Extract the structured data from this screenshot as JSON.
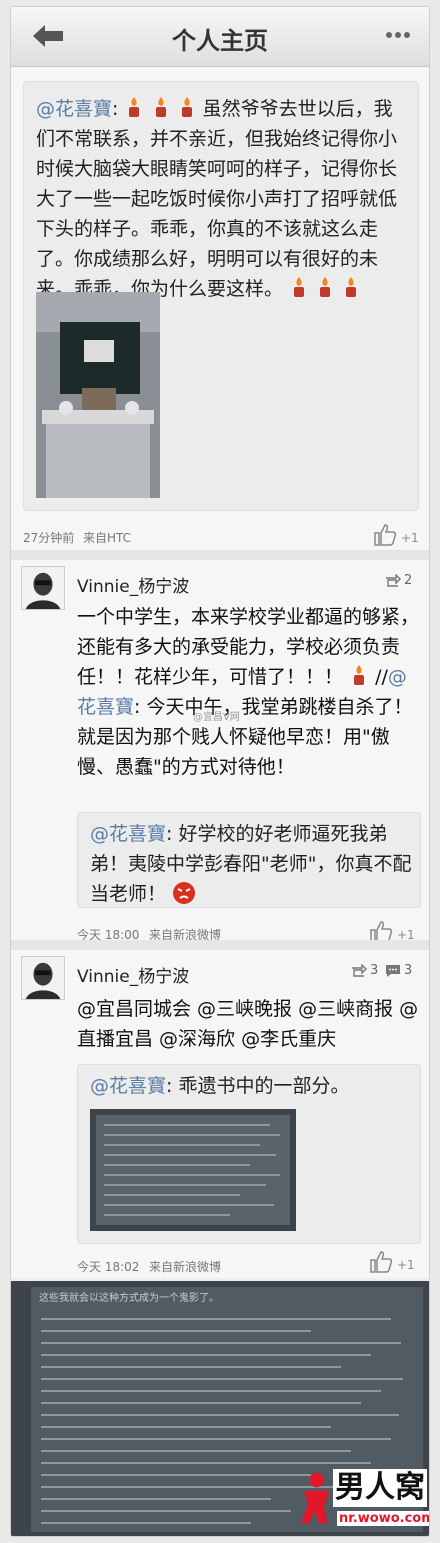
{
  "header": {
    "title": "个人主页"
  },
  "post1": {
    "mention": "@花喜寶",
    "text": "虽然爷爷去世以后，我们不常联系，并不亲近，但我始终记得你小时候大脑袋大眼睛笑呵呵的样子，记得你长大了一些一起吃饭时候你小声打了招呼就低下头的样子。乖乖，你真的不该就这么走了。你成绩那么好，明明可以有很好的未来。乖乖，你为什么要这样。",
    "time": "27分钟前",
    "source": "来自HTC",
    "likes": "+1"
  },
  "post2": {
    "user": "Vinnie_杨宁波",
    "reposts": "2",
    "text_a": "一个中学生，本来学校学业都逼的够紧，还能有多大的承受能力，学校必须负责任！！花样少年，可惜了！！！",
    "text_b_prefix": "//",
    "mention": "@花喜寶",
    "text_c": ": 今天中午，我堂弟跳楼自杀了！就是因为那个贱人怀疑他早恋！用\"傲慢、愚蠢\"的方式对待他！",
    "watermark": "@宜昌V网",
    "quote_mention": "@花喜寶",
    "quote_text": ": 好学校的好老师逼死我弟弟！夷陵中学彭春阳\"老师\"，你真不配当老师！",
    "time": "今天 18:00",
    "source": "来自新浪微博",
    "likes": "+1"
  },
  "post3": {
    "user": "Vinnie_杨宁波",
    "reposts": "3",
    "comments": "3",
    "mentions": "@宜昌同城会 @三峡晚报 @三峡商报 @直播宜昌 @深海欣 @李氏重庆",
    "quote_mention": "@花喜寶",
    "quote_text": ": 乖遗书中的一部分。",
    "time": "今天 18:02",
    "source": "来自新浪微博",
    "likes": "+1"
  },
  "bottom_photo": {
    "top_line": "这些我就会以这种方式成为一个鬼影了。",
    "logo_text": "男人窝",
    "logo_url": "nr.wowo.com"
  },
  "colors": {
    "link": "#5a7ea8",
    "header_bg": "#e6e6e6",
    "candle_flame": "#f08a1c"
  }
}
